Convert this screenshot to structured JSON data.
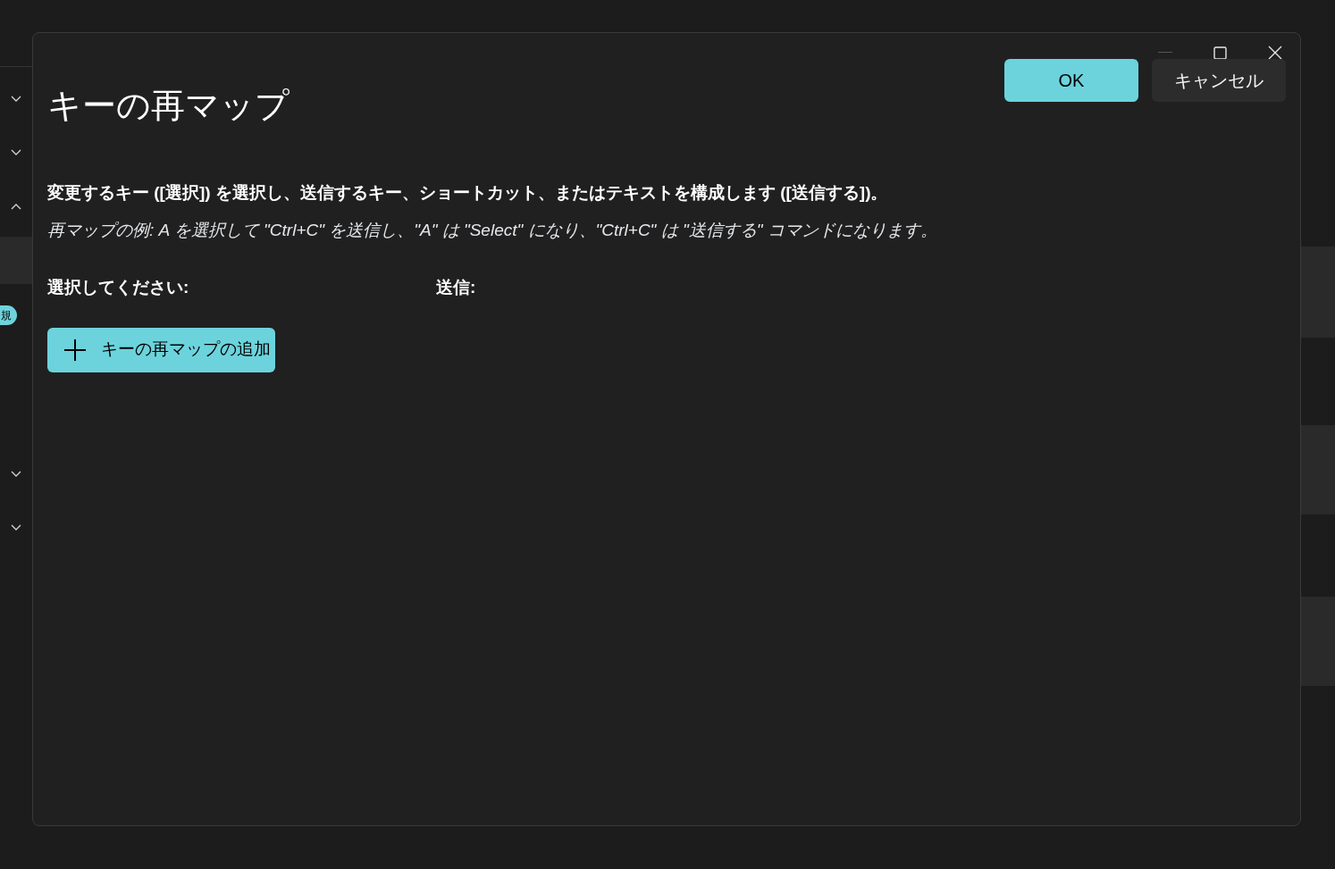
{
  "background": {
    "chevrons": [
      {
        "expanded": false
      },
      {
        "expanded": false
      },
      {
        "expanded": true
      },
      {
        "expanded": false
      },
      {
        "expanded": false
      }
    ],
    "badge": "規"
  },
  "dialog": {
    "title": "キーの再マップ",
    "buttons": [
      {
        "label": "OK",
        "kind": "primary"
      },
      {
        "label": "キャンセル",
        "kind": "secondary"
      }
    ],
    "description": "変更するキー ([選択]) を選択し、送信するキー、ショートカット、またはテキストを構成します ([送信する])。",
    "example": "再マップの例: A を選択して \"Ctrl+C\" を送信し、\"A\" は \"Select\" になり、\"Ctrl+C\" は \"送信する\" コマンドになります。",
    "columns": [
      "選択してください:",
      "送信:"
    ],
    "add_button": "キーの再マップの追加"
  }
}
